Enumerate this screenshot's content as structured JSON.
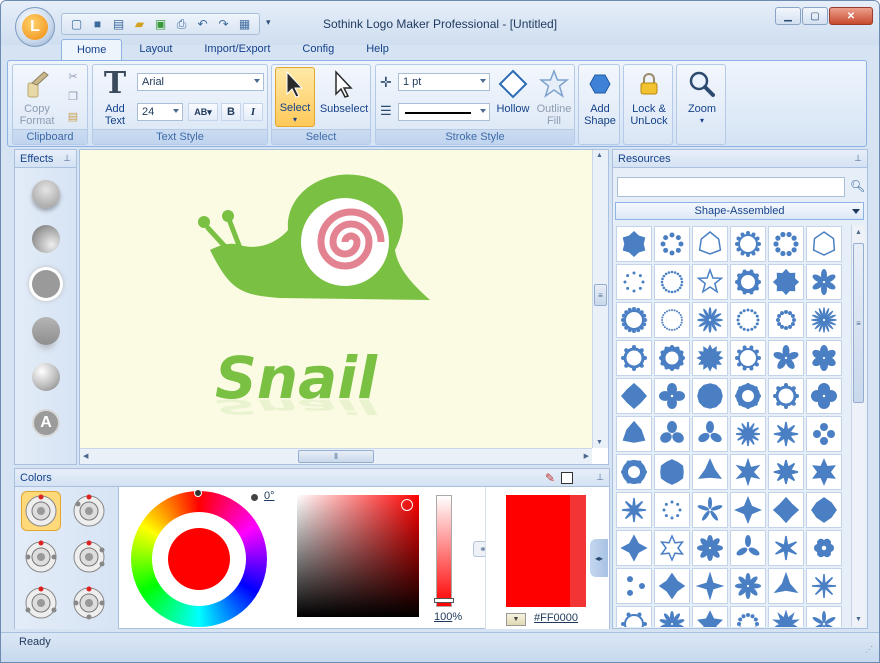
{
  "window": {
    "title": "Sothink Logo Maker Professional - [Untitled]"
  },
  "quick_access": [
    "new-icon",
    "save-icon",
    "import-icon",
    "open-icon",
    "export-icon",
    "print-icon",
    "undo-icon",
    "redo-icon",
    "save-as-icon"
  ],
  "tabs": [
    {
      "label": "Home",
      "active": true
    },
    {
      "label": "Layout"
    },
    {
      "label": "Import/Export"
    },
    {
      "label": "Config"
    },
    {
      "label": "Help"
    }
  ],
  "ribbon": {
    "clipboard": {
      "label": "Clipboard",
      "copy_format": "Copy\nFormat"
    },
    "text_style": {
      "label": "Text Style",
      "add_text": "Add\nText",
      "font": "Arial",
      "size": "24",
      "bold": "B",
      "italic": "I"
    },
    "select": {
      "label": "Select",
      "select": "Select",
      "subselect": "Subselect"
    },
    "stroke_style": {
      "label": "Stroke Style",
      "width": "1 pt",
      "hollow": "Hollow",
      "outline_fill": "Outline\nFill"
    },
    "add_shape": "Add\nShape",
    "lock_unlock": "Lock &\nUnLock",
    "zoom": "Zoom"
  },
  "effects": {
    "title": "Effects"
  },
  "canvas": {
    "logo_text": "Snail"
  },
  "resources": {
    "title": "Resources",
    "search_value": "",
    "category": "Shape-Assembled"
  },
  "colors": {
    "title": "Colors",
    "hue_angle": "0°",
    "opacity": "100",
    "opacity_unit": "%",
    "hex": "#FF0000",
    "current_color": "#FF0000"
  },
  "status": {
    "text": "Ready"
  }
}
